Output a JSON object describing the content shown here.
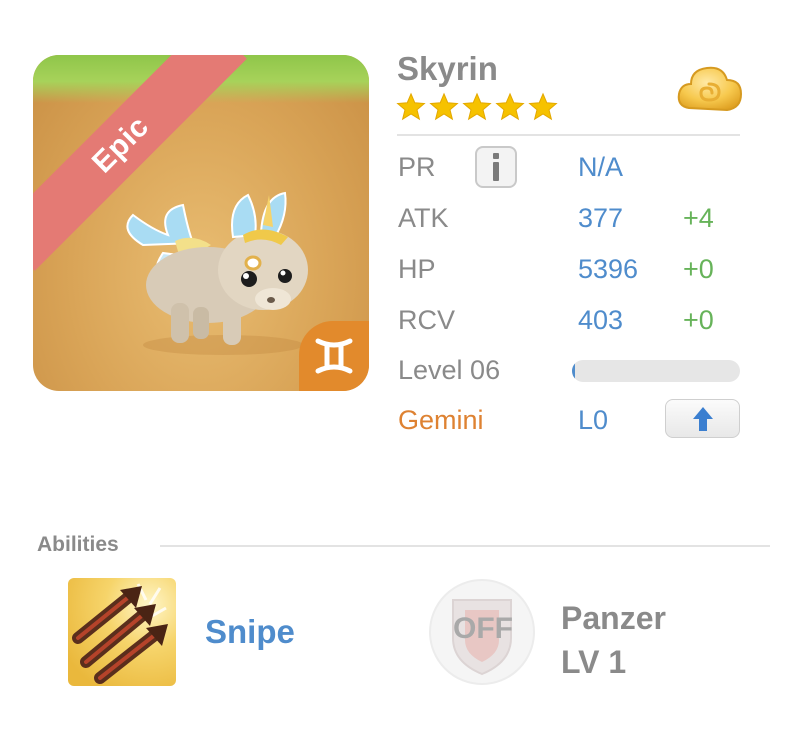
{
  "pet": {
    "name": "Skyrin",
    "rarity": "Epic",
    "star_count": 5,
    "zodiac_symbol": "♊",
    "zodiac_icon": "gemini-icon"
  },
  "stats": {
    "pr": {
      "label": "PR",
      "value": "N/A"
    },
    "atk": {
      "label": "ATK",
      "value": "377",
      "bonus": "+4"
    },
    "hp": {
      "label": "HP",
      "value": "5396",
      "bonus": "+0"
    },
    "rcv": {
      "label": "RCV",
      "value": "403",
      "bonus": "+0"
    },
    "level": {
      "label": "Level 06",
      "progress": 0.02
    },
    "zodiac": {
      "label": "Gemini",
      "value": "L0"
    }
  },
  "abilities": {
    "title": "Abilities",
    "active": {
      "name": "Snipe",
      "icon": "snipe-arrows-icon"
    },
    "passive": {
      "badge": "OFF",
      "name_line1": "Panzer",
      "name_line2": "LV 1",
      "icon": "shield-off-icon"
    }
  },
  "colors": {
    "accent_blue": "#4f8ccc",
    "bonus_green": "#67b35a",
    "zodiac_orange": "#de8232",
    "epic_ribbon": "#e47a74",
    "star_gold": "#f6c200"
  },
  "icons": {
    "currency": "gold-cloud-icon",
    "info": "info-icon",
    "upgrade": "up-arrow-icon"
  }
}
